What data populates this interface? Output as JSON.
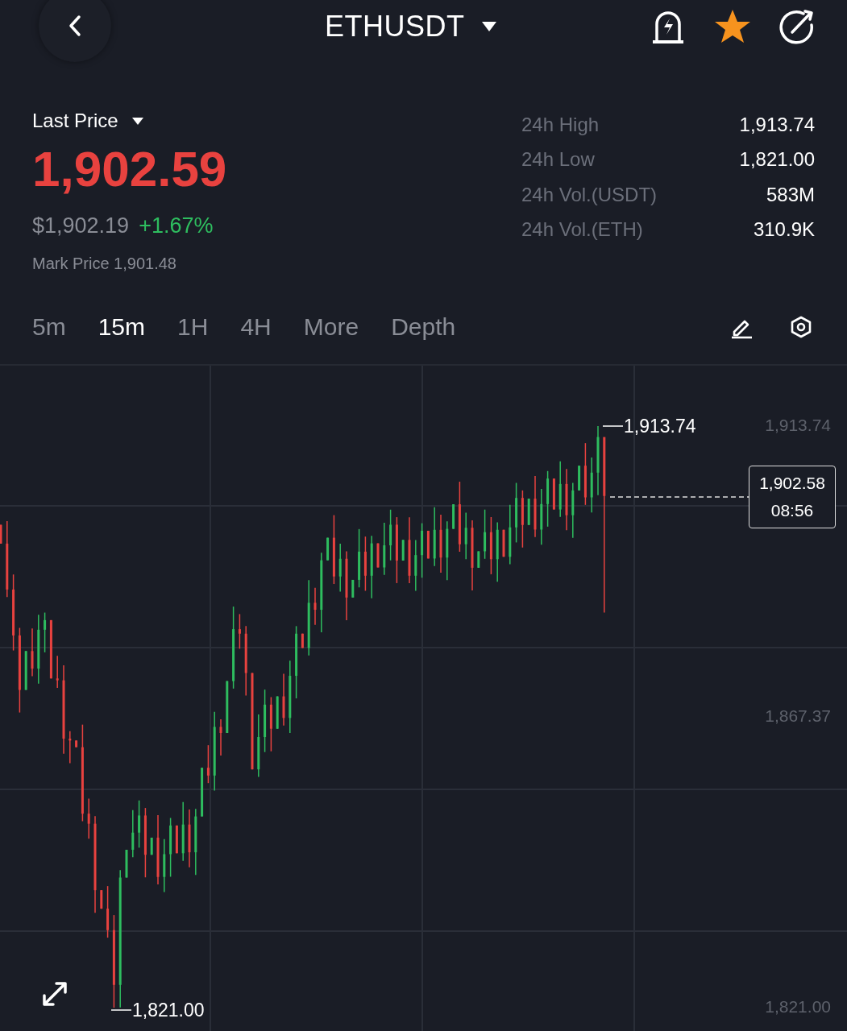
{
  "header": {
    "title": "ETHUSDT",
    "favorite": true
  },
  "price": {
    "label": "Last Price",
    "last": "1,902.59",
    "usd": "$1,902.19",
    "change": "+1.67%",
    "mark": "Mark Price 1,901.48"
  },
  "stats": [
    {
      "label": "24h High",
      "value": "1,913.74"
    },
    {
      "label": "24h Low",
      "value": "1,821.00"
    },
    {
      "label": "24h Vol.(USDT)",
      "value": "583M"
    },
    {
      "label": "24h Vol.(ETH)",
      "value": "310.9K"
    }
  ],
  "intervals": [
    {
      "label": "5m",
      "selected": false
    },
    {
      "label": "15m",
      "selected": true
    },
    {
      "label": "1H",
      "selected": false
    },
    {
      "label": "4H",
      "selected": false
    },
    {
      "label": "More",
      "selected": false
    },
    {
      "label": "Depth",
      "selected": false
    }
  ],
  "chart": {
    "axis_labels": [
      "1,913.74",
      "1,867.37",
      "1,821.00"
    ],
    "high_marker": "1,913.74",
    "low_marker": "1,821.00",
    "current_price": "1,902.58",
    "countdown": "08:56"
  }
}
